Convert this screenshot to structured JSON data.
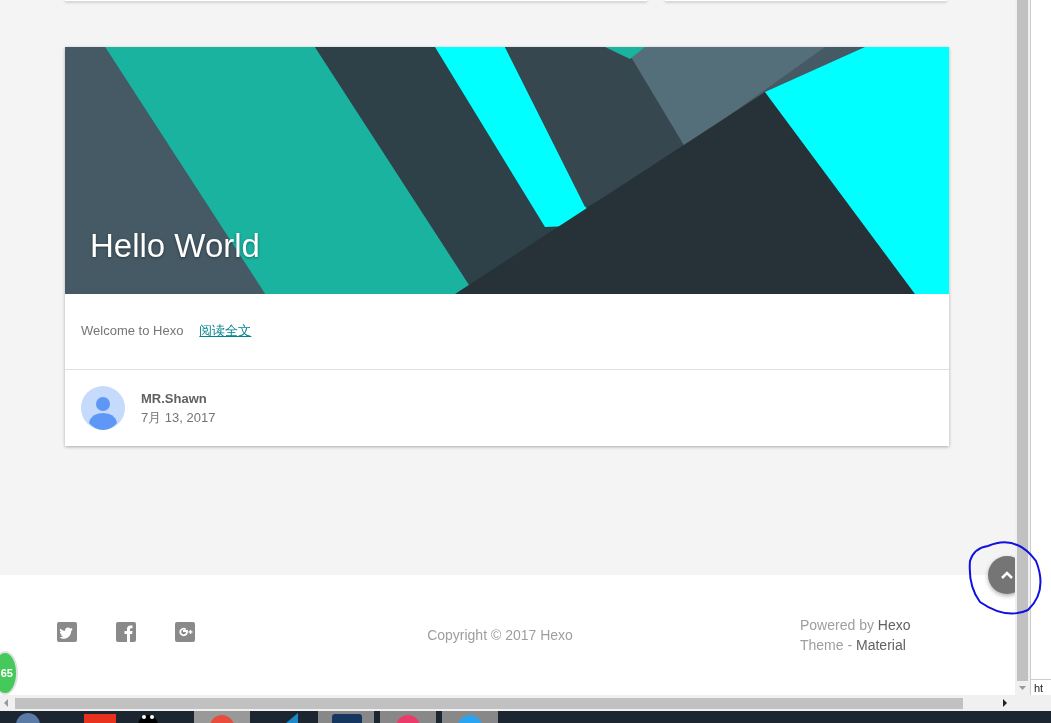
{
  "post": {
    "title": "Hello World",
    "excerpt": "Welcome to Hexo",
    "read_more": "阅读全文",
    "author": "MR.Shawn",
    "date": "7月 13, 2017"
  },
  "footer": {
    "copyright": "Copyright © 2017 Hexo",
    "powered_label": "Powered by",
    "powered_link": "Hexo",
    "theme_label": "Theme -",
    "theme_link": "Material"
  },
  "floating_badge": "65",
  "status_text": "ht"
}
